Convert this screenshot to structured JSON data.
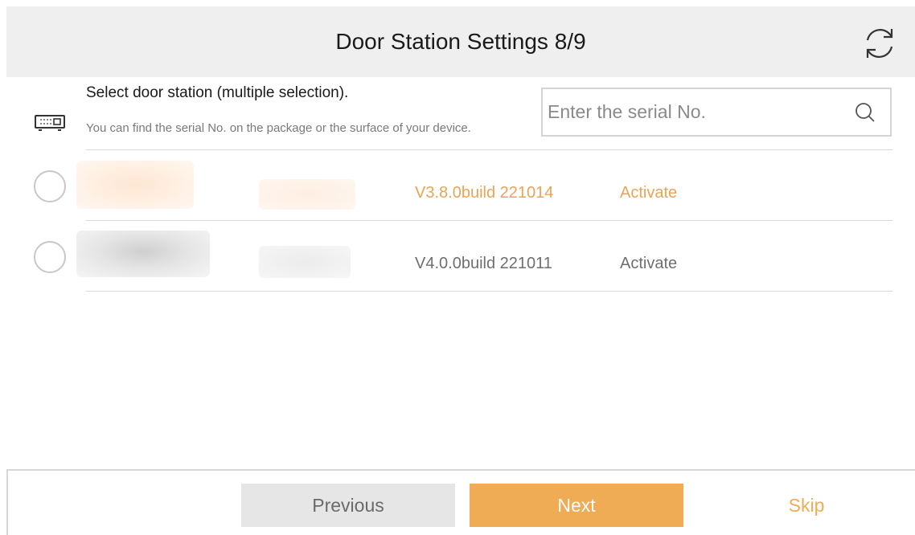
{
  "header": {
    "title": "Door Station Settings 8/9",
    "refresh_icon": "refresh-icon"
  },
  "selection": {
    "title": "Select door station (multiple selection).",
    "hint": "You can find the serial No. on the package or the surface of your device.",
    "device_icon": "door-station-icon"
  },
  "search": {
    "placeholder": "Enter the serial No.",
    "value": "",
    "icon": "search-icon"
  },
  "devices": [
    {
      "firmware": "V3.8.0build 221014",
      "action": "Activate",
      "selected": false,
      "highlighted": true
    },
    {
      "firmware": "V4.0.0build 221011",
      "action": "Activate",
      "selected": false,
      "highlighted": false
    }
  ],
  "footer": {
    "previous_label": "Previous",
    "next_label": "Next",
    "skip_label": "Skip"
  },
  "colors": {
    "accent": "#efac55",
    "highlight_text": "#e9a456",
    "normal_text": "#6f6f6f",
    "header_bg": "#efefef"
  }
}
